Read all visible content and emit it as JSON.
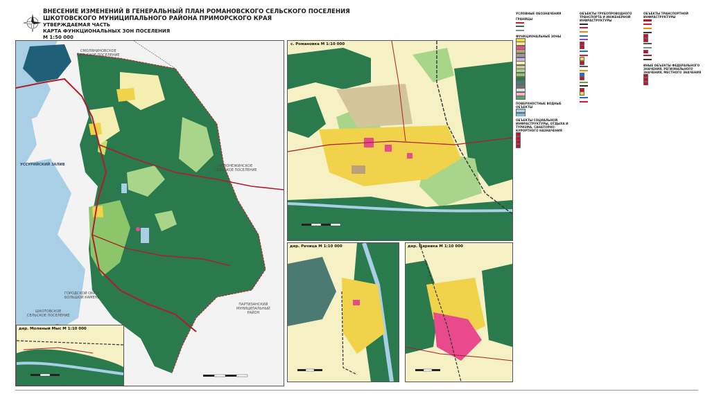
{
  "title": {
    "line1": "ВНЕСЕНИЕ ИЗМЕНЕНИЙ В ГЕНЕРАЛЬНЫЙ ПЛАН РОМАНОВСКОГО СЕЛЬСКОГО ПОСЕЛЕНИЯ",
    "line2": "ШКОТОВСКОГО МУНИЦИПАЛЬНОГО РАЙОНА ПРИМОРСКОГО КРАЯ",
    "line3": "УТВЕРЖДАЕМАЯ ЧАСТЬ",
    "line4": "КАРТА ФУНКЦИОНАЛЬНЫХ ЗОН ПОСЕЛЕНИЯ",
    "line5": "М 1:50 000"
  },
  "main_map": {
    "labels": {
      "smolyaninovskoe": "СМОЛЯНИНОВСКОЕ\nСЕЛЬСКОЕ ПОСЕЛЕНИЕ",
      "ussuri_bay": "УССУРИЙСКИЙ ЗАЛИВ",
      "novonezhinskoe": "НОВОНЕЖИНСКОЕ\nСЕЛЬСКОЕ ПОСЕЛЕНИЕ",
      "bolshoi_kamen": "ГОРОДСКОЙ ОКРУГ\nБОЛЬШОЙ КАМЕНЬ",
      "partizansky": "ПАРТИЗАНСКИЙ\nМУНИЦИПАЛЬНЫЙ\nРАЙОН",
      "shkotovskoe": "ШКОТОВСКОЕ\nСЕЛЬСКОЕ ПОСЕЛЕНИЕ"
    }
  },
  "insets": {
    "romanovka": "с. Романовка М 1:10 000",
    "rechitsa": "дер. Речица М 1:10 000",
    "tsarevka": "дер. Царевка М 1:10 000",
    "molenyi_mys": "дер. Моленый Мыс М 1:10 000"
  },
  "legend": {
    "col1_title": "УСЛОВНЫЕ ОБОЗНАЧЕНИЯ",
    "col1_sub": "ГРАНИЦЫ",
    "col1_zones_head": "ФУНКЦИОНАЛЬНЫЕ ЗОНЫ",
    "col1_surface_head": "ПОВЕРХНОСТНЫЕ ВОДНЫЕ ОБЪЕКТЫ",
    "col1_social_head": "ОБЪЕКТЫ СОЦИАЛЬНОЙ ИНФРАСТРУКТУРЫ, ОТДЫХА И ТУРИЗМА, САНАТОРНО-КУРОРТНОГО НАЗНАЧЕНИЯ",
    "col2_title": "ОБЪЕКТЫ ТРУБОПРОВОДНОГО ТРАНСПОРТА И ИНЖЕНЕРНОЙ ИНФРАСТРУКТУРЫ",
    "col3_title": "ОБЪЕКТЫ ТРАНСПОРТНОЙ ИНФРАСТРУКТУРЫ",
    "col3_other_head": "ИНЫЕ ОБЪЕКТЫ ФЕДЕРАЛЬНОГО ЗНАЧЕНИЯ, РЕГИОНАЛЬНОГО ЗНАЧЕНИЯ, МЕСТНОГО ЗНАЧЕНИЯ"
  },
  "colors": {
    "forest": "#2a7a4e",
    "light_green": "#a8d58a",
    "agri": "#f4eeb0",
    "residential": "#f0d34a",
    "public": "#e84a8c",
    "industrial": "#b8a07a",
    "water": "#a9cfe6",
    "road": "#b01c2a"
  }
}
